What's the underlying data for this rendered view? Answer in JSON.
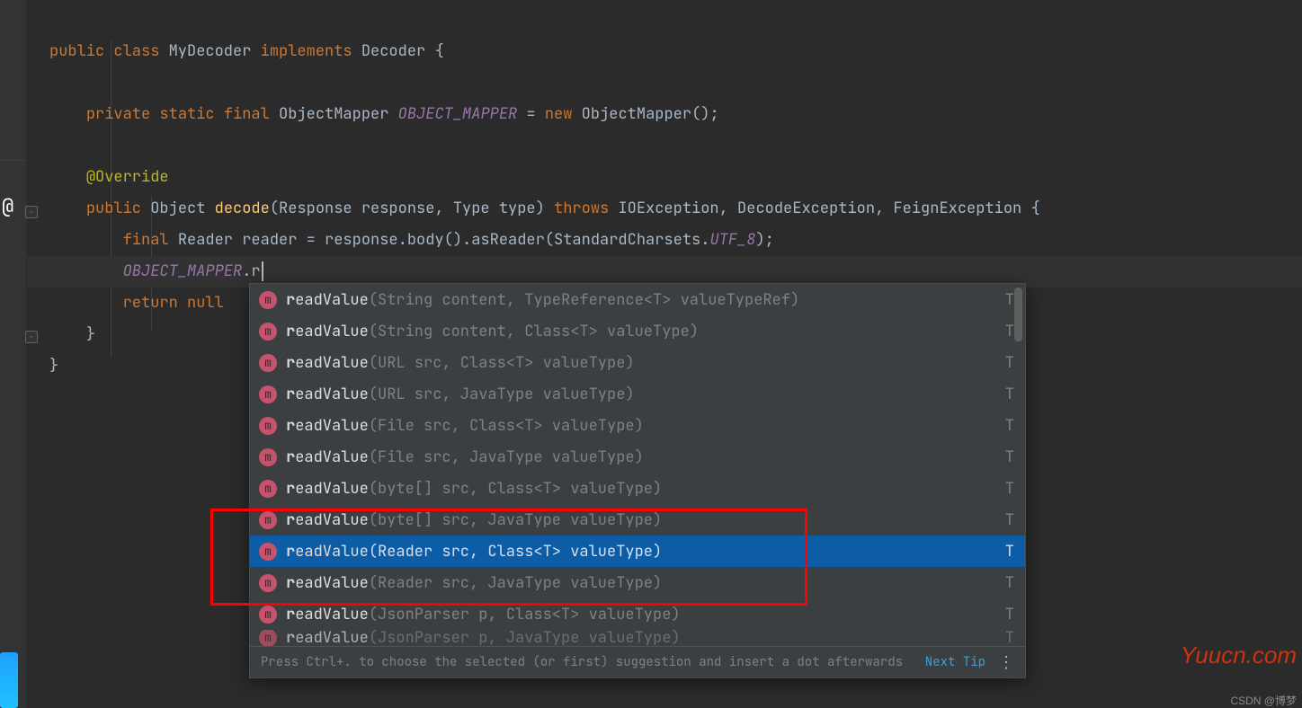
{
  "gutter": {
    "at": "@",
    "fold": "-"
  },
  "code": {
    "l1": {
      "kw_public": "public",
      "kw_class": "class",
      "name": "MyDecoder",
      "kw_implements": "implements",
      "iface": "Decoder",
      "brace": "{"
    },
    "l3": {
      "kw_private": "private",
      "kw_static": "static",
      "kw_final": "final",
      "type": "ObjectMapper",
      "field": "OBJECT_MAPPER",
      "eq": "=",
      "kw_new": "new",
      "ctor": "ObjectMapper",
      "tail": "();"
    },
    "l5": {
      "anno": "@Override"
    },
    "l6": {
      "kw_public": "public",
      "ret": "Object",
      "name": "decode",
      "sig": "(Response response, Type type)",
      "kw_throws": "throws",
      "ex1": "IOException",
      "ex2": "DecodeException",
      "ex3": "FeignException",
      "brace": "{"
    },
    "l7": {
      "kw_final": "final",
      "type": "Reader",
      "var": "reader",
      "eq": "=",
      "call1": "response.body().asReader(StandardCharsets.",
      "const": "UTF_8",
      "tail": ");"
    },
    "l8": {
      "obj": "OBJECT_MAPPER",
      "dot": ".",
      "typing": "r"
    },
    "l9": {
      "kw_return": "return",
      "kw_null": "null"
    },
    "l10": {
      "brace": "}"
    },
    "l11": {
      "brace": "}"
    }
  },
  "popup": {
    "items": [
      {
        "name": "readValue",
        "params": "(String content, TypeReference<T> valueTypeRef)",
        "ret": "T",
        "bold": "r"
      },
      {
        "name": "readValue",
        "params": "(String content, Class<T> valueType)",
        "ret": "T",
        "bold": "r"
      },
      {
        "name": "readValue",
        "params": "(URL src, Class<T> valueType)",
        "ret": "T",
        "bold": "r"
      },
      {
        "name": "readValue",
        "params": "(URL src, JavaType valueType)",
        "ret": "T",
        "bold": "r"
      },
      {
        "name": "readValue",
        "params": "(File src, Class<T> valueType)",
        "ret": "T",
        "bold": "r"
      },
      {
        "name": "readValue",
        "params": "(File src, JavaType valueType)",
        "ret": "T",
        "bold": "r"
      },
      {
        "name": "readValue",
        "params": "(byte[] src, Class<T> valueType)",
        "ret": "T",
        "bold": "r"
      },
      {
        "name": "readValue",
        "params": "(byte[] src, JavaType valueType)",
        "ret": "T",
        "bold": "r"
      },
      {
        "name": "readValue",
        "params": "(Reader src, Class<T> valueType)",
        "ret": "T",
        "bold": "r",
        "selected": true
      },
      {
        "name": "readValue",
        "params": "(Reader src, JavaType valueType)",
        "ret": "T",
        "bold": "r"
      },
      {
        "name": "readValue",
        "params": "(JsonParser p, Class<T> valueType)",
        "ret": "T",
        "bold": "r"
      },
      {
        "name": "readValue",
        "params": "(JsonParser p, JavaType valueType)",
        "ret": "T",
        "bold": "r",
        "cut": true
      }
    ],
    "hint": "Press Ctrl+. to choose the selected (or first) suggestion and insert a dot afterwards",
    "next_tip": "Next Tip",
    "m": "m",
    "dots": "⋮"
  },
  "red_box_range": {
    "start_index": 7,
    "end_index": 9
  },
  "watermarks": {
    "site": "Yuucn.com",
    "csdn": "CSDN @博梦"
  }
}
